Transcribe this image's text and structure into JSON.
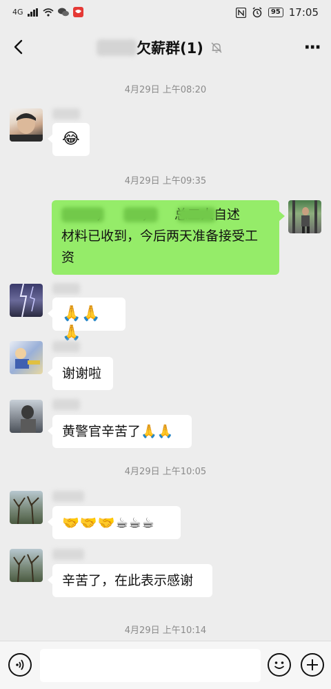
{
  "status_bar": {
    "network": "4G",
    "battery": "95",
    "time": "17:05"
  },
  "header": {
    "title": "欠薪群(1)"
  },
  "messages": [
    {
      "type": "time",
      "text": "4月29日 上午08:20"
    },
    {
      "type": "left",
      "content": "😂"
    },
    {
      "type": "time",
      "text": "4月29日 上午09:35"
    },
    {
      "type": "right",
      "line1": "，　　　，　　总三人自述",
      "line2": "材料已收到，今后两天准备接受工",
      "line3": "资"
    },
    {
      "type": "left",
      "content": "🙏🙏🙏"
    },
    {
      "type": "left",
      "content": "谢谢啦"
    },
    {
      "type": "left",
      "content": "黄警官辛苦了🙏🙏"
    },
    {
      "type": "time",
      "text": "4月29日 上午10:05"
    },
    {
      "type": "left",
      "content": "🤝🤝🤝☕☕☕"
    },
    {
      "type": "left",
      "content": "辛苦了，在此表示感谢"
    },
    {
      "type": "time",
      "text": "4月29日 上午10:14"
    }
  ],
  "input_bar": {
    "placeholder": ""
  },
  "colors": {
    "background": "#ededed",
    "my_bubble": "#95ec69",
    "other_bubble": "#ffffff",
    "timestamp_text": "#8a8a8a"
  }
}
